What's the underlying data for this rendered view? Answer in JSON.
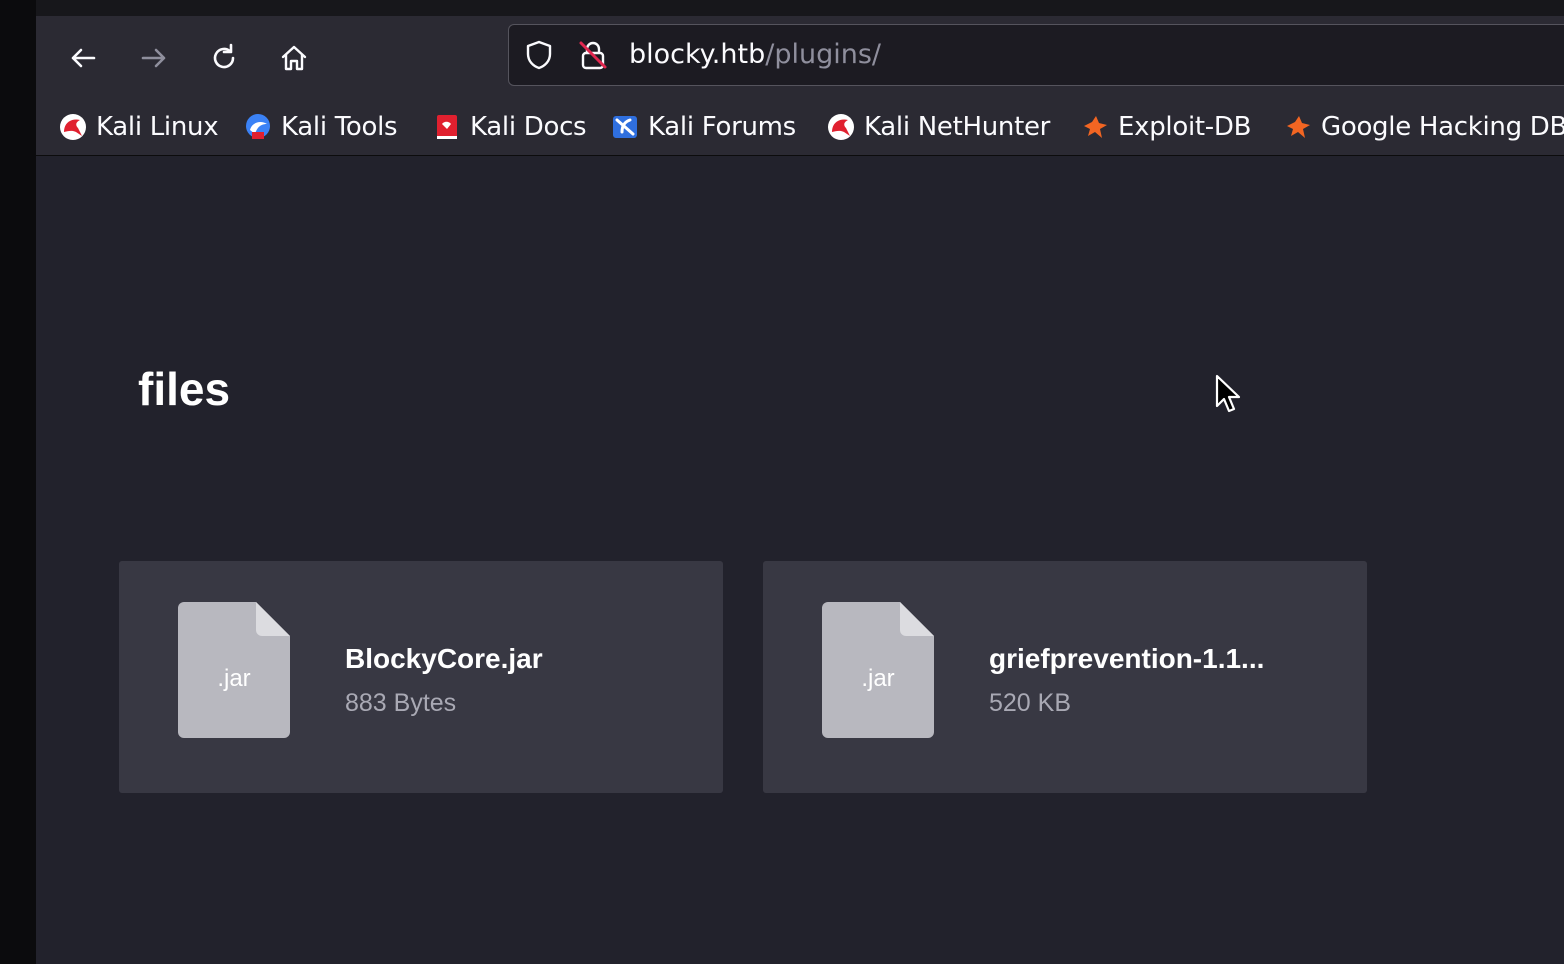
{
  "browser": {
    "nav": {
      "back_icon": "arrow-left-icon",
      "forward_icon": "arrow-right-icon",
      "reload_icon": "reload-icon",
      "home_icon": "home-icon"
    },
    "url": {
      "host": "blocky.htb",
      "path": "/plugins/",
      "shield_icon": "shield-icon",
      "insecure_lock_icon": "insecure-lock-icon"
    },
    "bookmarks": [
      {
        "label": "Kali Linux",
        "icon": "kali-dragon-icon"
      },
      {
        "label": "Kali Tools",
        "icon": "kali-tools-icon"
      },
      {
        "label": "Kali Docs",
        "icon": "kali-docs-icon"
      },
      {
        "label": "Kali Forums",
        "icon": "kali-forums-icon"
      },
      {
        "label": "Kali NetHunter",
        "icon": "kali-dragon-icon"
      },
      {
        "label": "Exploit-DB",
        "icon": "exploit-db-icon"
      },
      {
        "label": "Google Hacking DB",
        "icon": "exploit-db-icon"
      }
    ]
  },
  "page": {
    "title": "files",
    "files": [
      {
        "ext": ".jar",
        "name": "BlockyCore.jar",
        "size": "883 Bytes"
      },
      {
        "ext": ".jar",
        "name": "griefprevention-1.1...",
        "size": "520 KB"
      }
    ]
  },
  "colors": {
    "toolbar": "#2b2a33",
    "content_bg": "#22222c",
    "card_bg": "#383843",
    "file_icon": "#b8b8bf"
  }
}
